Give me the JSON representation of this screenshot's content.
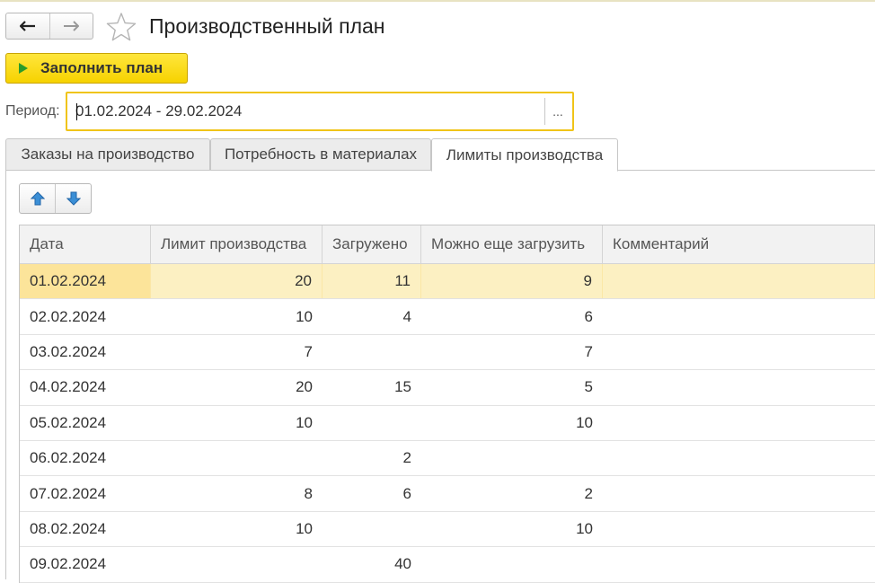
{
  "header": {
    "title": "Производственный план"
  },
  "toolbar": {
    "fill_label": "Заполнить план"
  },
  "period": {
    "label": "Период:",
    "value": "01.02.2024 - 29.02.2024",
    "choose_label": "..."
  },
  "tabs": [
    {
      "label": "Заказы на производство",
      "active": false
    },
    {
      "label": "Потребность в материалах",
      "active": false
    },
    {
      "label": "Лимиты производства",
      "active": true
    }
  ],
  "table": {
    "columns": [
      "Дата",
      "Лимит производства",
      "Загружено",
      "Можно еще загрузить",
      "Комментарий"
    ],
    "rows": [
      [
        "01.02.2024",
        "20",
        "11",
        "9",
        ""
      ],
      [
        "02.02.2024",
        "10",
        "4",
        "6",
        ""
      ],
      [
        "03.02.2024",
        "7",
        "",
        "7",
        ""
      ],
      [
        "04.02.2024",
        "20",
        "15",
        "5",
        ""
      ],
      [
        "05.02.2024",
        "10",
        "",
        "10",
        ""
      ],
      [
        "06.02.2024",
        "",
        "2",
        "",
        ""
      ],
      [
        "07.02.2024",
        "8",
        "6",
        "2",
        ""
      ],
      [
        "08.02.2024",
        "10",
        "",
        "10",
        ""
      ],
      [
        "09.02.2024",
        "",
        "40",
        "",
        ""
      ]
    ]
  },
  "colors": {
    "accent": "#f6d200",
    "selected_row": "#fcf0c2"
  }
}
